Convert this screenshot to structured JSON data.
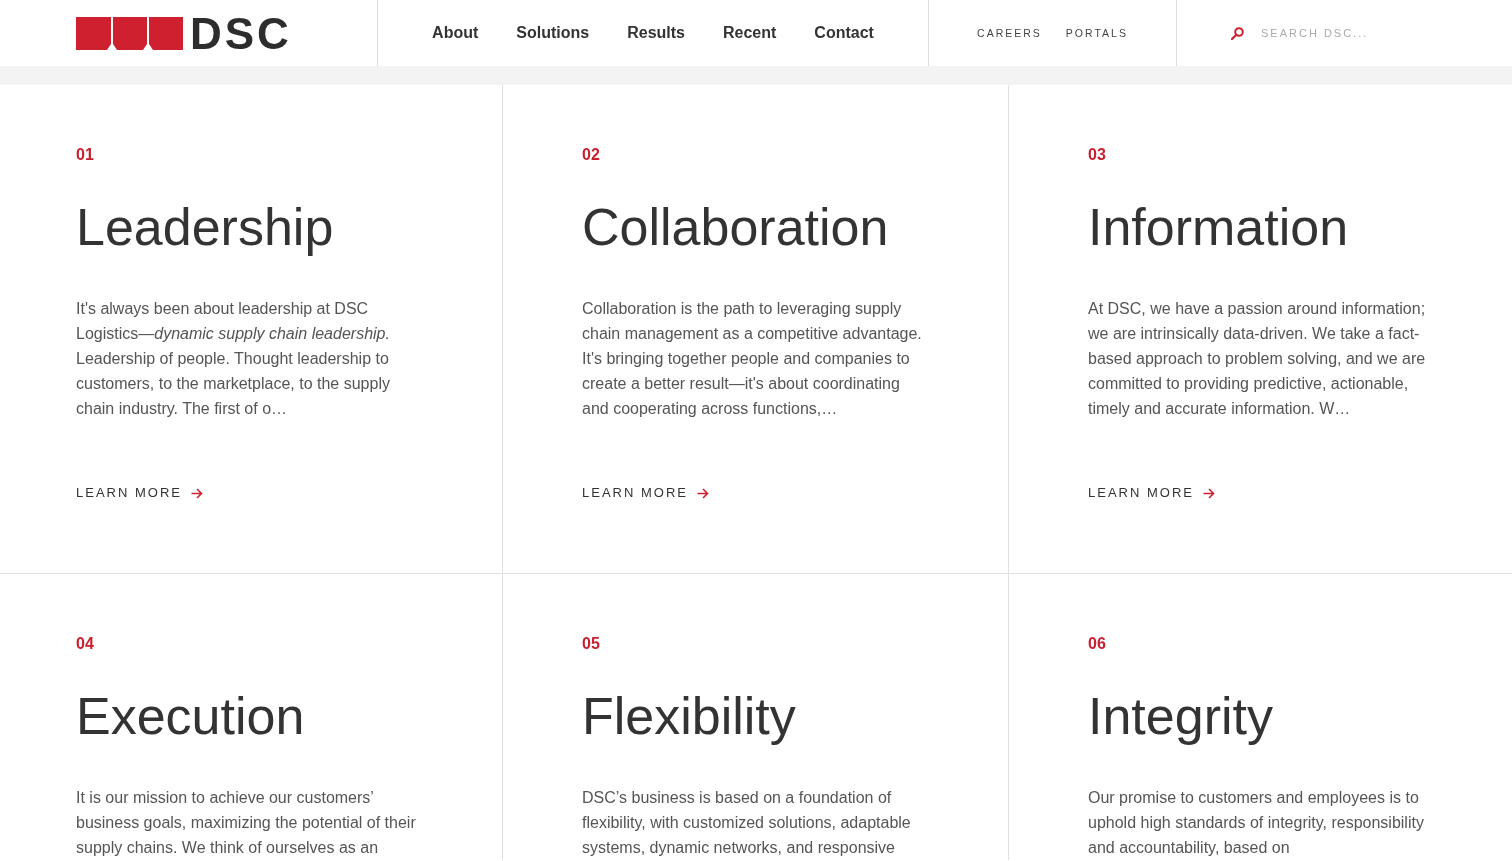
{
  "header": {
    "logo": {
      "text": "DSC"
    },
    "nav": [
      {
        "label": "About"
      },
      {
        "label": "Solutions"
      },
      {
        "label": "Results"
      },
      {
        "label": "Recent"
      },
      {
        "label": "Contact"
      }
    ],
    "utility_links": [
      "CAREERS",
      "PORTALS"
    ],
    "search": {
      "placeholder": "SEARCH DSC..."
    }
  },
  "cards": [
    {
      "number": "01",
      "title": "Leadership",
      "body": "It's always been about leadership at DSC Logistics—*dynamic supply chain leadership.* Leadership of people. Thought leadership to customers, to the marketplace, to the supply chain industry. The first of o…",
      "link": "LEARN MORE"
    },
    {
      "number": "02",
      "title": "Collaboration",
      "body": "Collaboration is the path to leveraging supply chain management as a competitive advantage. It's bringing together people and companies to create a better result—it's about coordinating and cooperating across functions,…",
      "link": "LEARN MORE"
    },
    {
      "number": "03",
      "title": "Information",
      "body": "At DSC, we have a passion around information; we are intrinsically data-driven. We take a fact-based approach to problem solving, and we are committed to providing predictive, actionable, timely and accurate information. W…",
      "link": "LEARN MORE"
    },
    {
      "number": "04",
      "title": "Execution",
      "body": "It is our mission to achieve our customers’ business goals, maximizing the potential of their supply chains. We think of ourselves as an"
    },
    {
      "number": "05",
      "title": "Flexibility",
      "body": "DSC’s business is based on a foundation of flexibility, with customized solutions, adaptable systems, dynamic networks, and responsive"
    },
    {
      "number": "06",
      "title": "Integrity",
      "body": "Our promise to customers and employees is to uphold high standards of integrity, responsibility and accountability, based on"
    }
  ]
}
